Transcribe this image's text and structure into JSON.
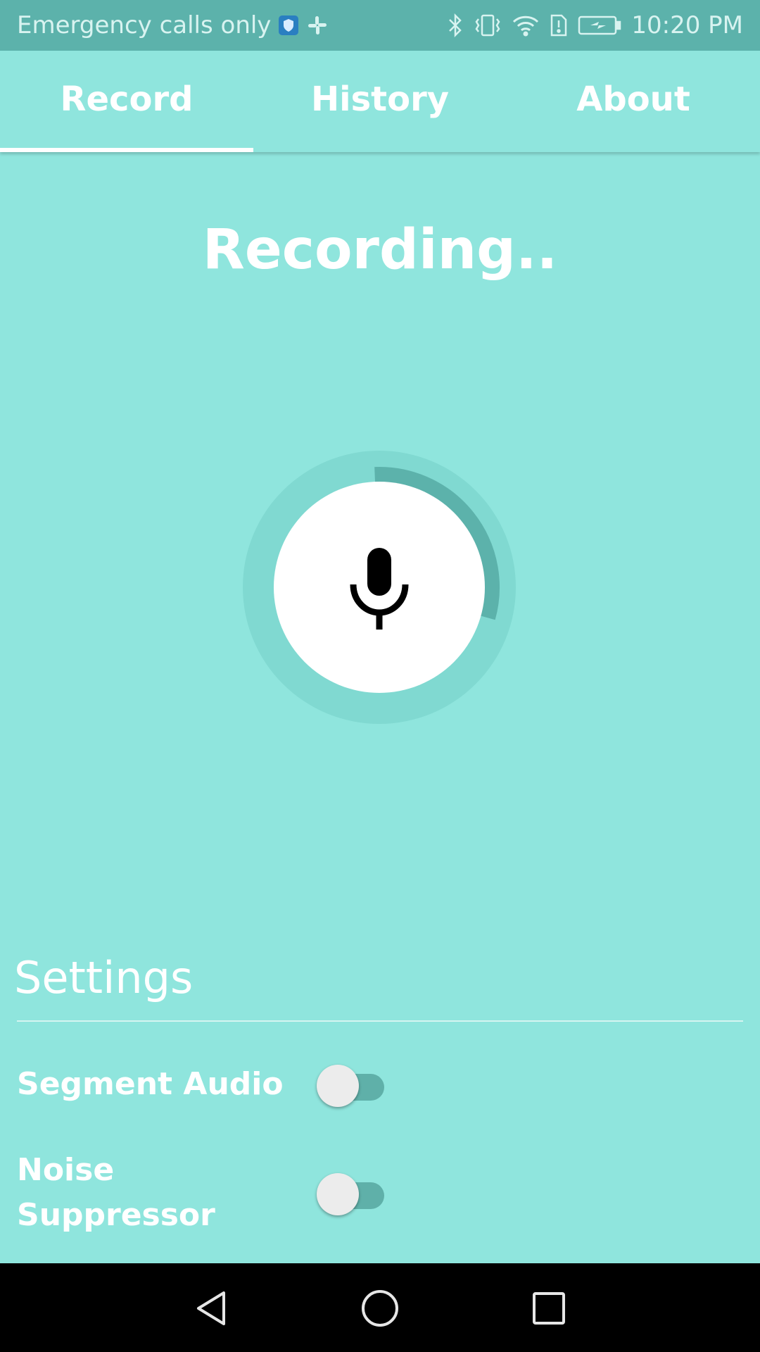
{
  "status_bar": {
    "carrier_text": "Emergency calls only",
    "time": "10:20 PM",
    "icons": [
      "shield-icon",
      "slack-icon",
      "bluetooth-icon",
      "vibrate-icon",
      "wifi-icon",
      "sim-alert-icon",
      "battery-charging-icon"
    ]
  },
  "tabs": [
    {
      "label": "Record",
      "active": true
    },
    {
      "label": "History",
      "active": false
    },
    {
      "label": "About",
      "active": false
    }
  ],
  "record": {
    "status_text": "Recording..",
    "progress_percent": 30,
    "accent_color": "#5cb2ab"
  },
  "settings": {
    "title": "Settings",
    "items": [
      {
        "label": "Segment Audio",
        "enabled": false
      },
      {
        "label": "Noise Suppressor",
        "enabled": false
      }
    ]
  },
  "nav_bar": {
    "buttons": [
      "back-icon",
      "home-icon",
      "recents-icon"
    ]
  }
}
